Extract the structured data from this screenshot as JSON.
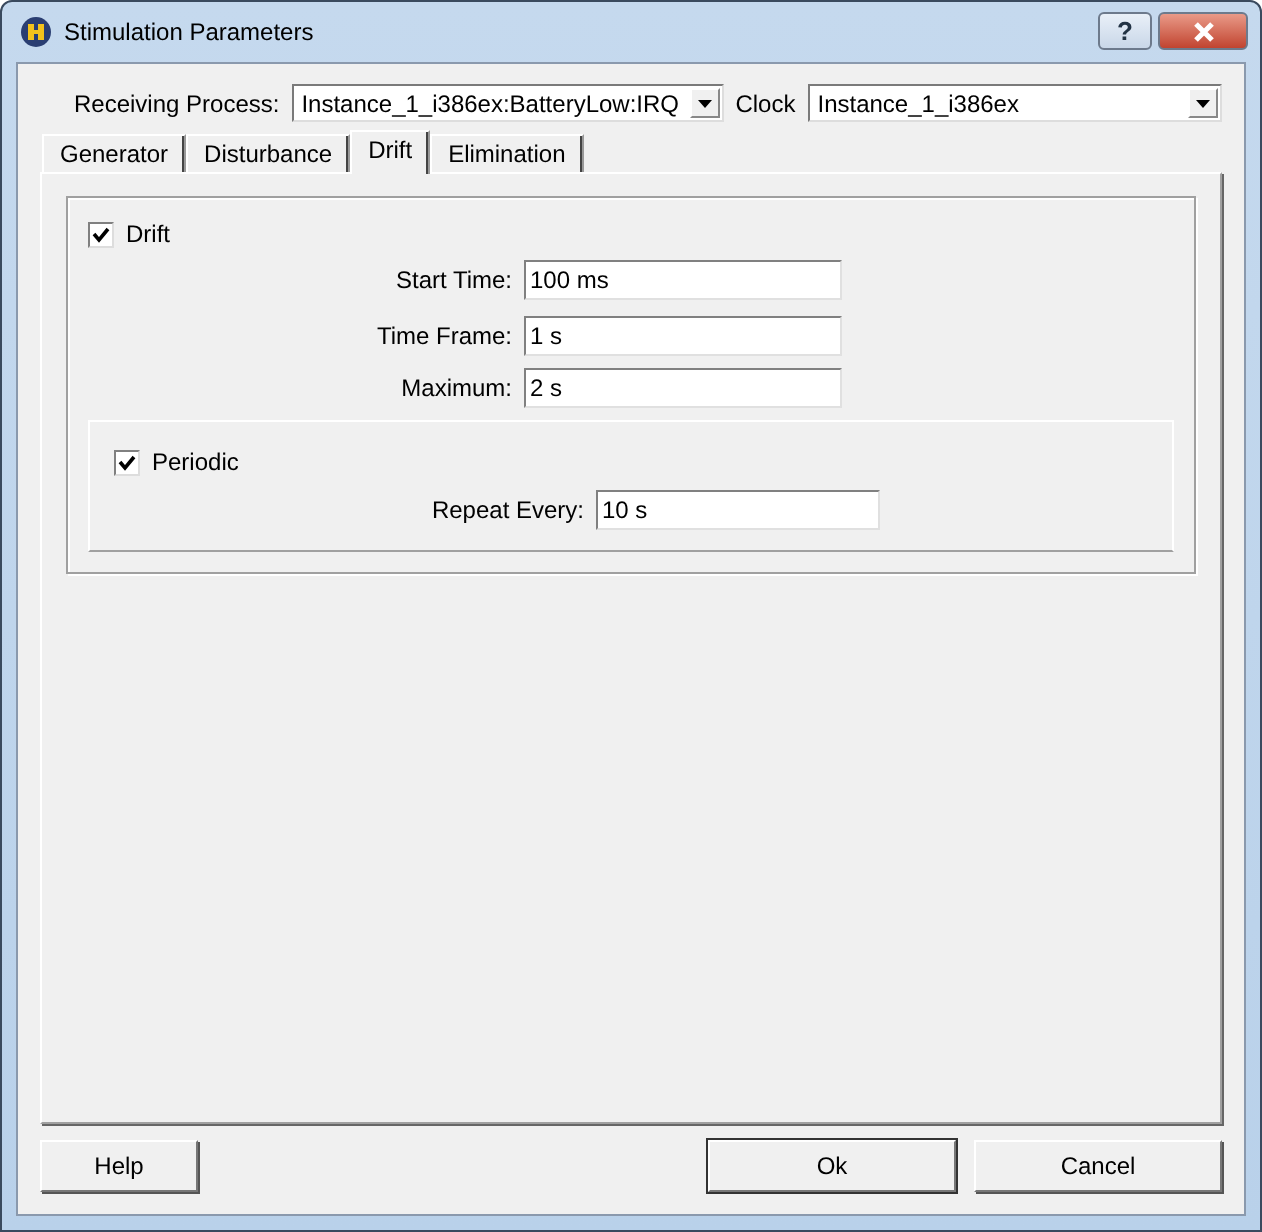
{
  "window": {
    "title": "Stimulation Parameters",
    "buttons": [
      "?"
    ]
  },
  "receiving_process": {
    "label": "Receiving Process:",
    "value": "Instance_1_i386ex:BatteryLow:IRQ"
  },
  "clock": {
    "label": "Clock",
    "value": "Instance_1_i386ex"
  },
  "tabs": [
    {
      "label": "Generator",
      "selected": false
    },
    {
      "label": "Disturbance",
      "selected": false
    },
    {
      "label": "Drift",
      "selected": true
    },
    {
      "label": "Elimination",
      "selected": false
    }
  ],
  "drift": {
    "label": "Drift",
    "checked": true,
    "fields": [
      {
        "label": "Start Time:",
        "value": "100 ms"
      },
      {
        "label": "Time Frame:",
        "value": "1 s"
      },
      {
        "label": "Maximum:",
        "value": "2 s"
      }
    ],
    "periodic": {
      "label": "Periodic",
      "checked": true,
      "field": {
        "label": "Repeat Every:",
        "value": "10 s"
      }
    }
  },
  "buttons": [
    {
      "label": "Help"
    },
    {
      "label": "Ok",
      "default": true
    },
    {
      "label": "Cancel",
      "default": false
    }
  ]
}
